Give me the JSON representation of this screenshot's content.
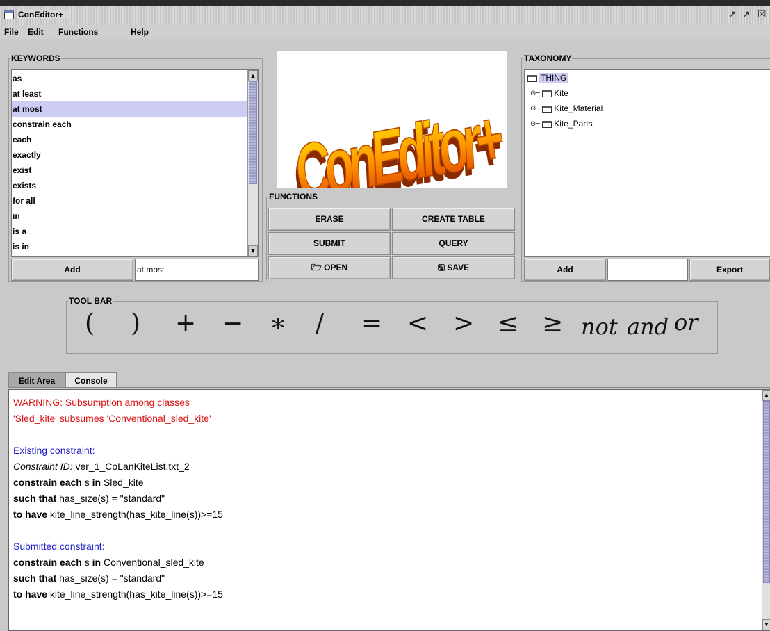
{
  "window": {
    "title": "ConEditor+",
    "controls": [
      "↗",
      "↗",
      "☒"
    ]
  },
  "menu": [
    "File",
    "Edit",
    "Functions",
    "Help"
  ],
  "keywords": {
    "title": "KEYWORDS",
    "items": [
      "as",
      "at least",
      "at most",
      "constrain each",
      "each",
      "exactly",
      "exist",
      "exists",
      "for all",
      "in",
      "is a",
      "is in"
    ],
    "selected_index": 2,
    "add_label": "Add",
    "field_value": "at most"
  },
  "logo": {
    "text": "ConEditor+"
  },
  "functions": {
    "title": "FUNCTIONS",
    "erase": "ERASE",
    "create_table": "CREATE TABLE",
    "submit": "SUBMIT",
    "query": "QUERY",
    "open": "OPEN",
    "save": "SAVE"
  },
  "taxonomy": {
    "title": "TAXONOMY",
    "root": "THING",
    "children": [
      "Kite",
      "Kite_Material",
      "Kite_Parts"
    ],
    "add_label": "Add",
    "field_value": "",
    "export_label": "Export"
  },
  "toolbar": {
    "title": "TOOL BAR",
    "symbols": [
      "(",
      ")",
      "+",
      "−",
      "∗",
      "/",
      "=",
      "<",
      ">",
      "≤",
      "≥"
    ],
    "words": [
      "not",
      "and",
      "or"
    ]
  },
  "tabs": [
    "Edit Area",
    "Console"
  ],
  "console": {
    "warning_1": "WARNING: Subsumption among classes",
    "warning_2": "'Sled_kite' subsumes 'Conventional_sled_kite'",
    "existing_header": "Existing constraint:",
    "id_label": "Constraint ID:",
    "id_value": " ver_1_CoLanKiteList.txt_2",
    "kw_constrain_each": "constrain each",
    "kw_in": "in",
    "kw_such_that": "such that",
    "kw_to_have": "to have",
    "var_s": " s ",
    "existing_class": " Sled_kite",
    "such_that_expr": " has_size(s) = \"standard\"",
    "to_have_expr": " kite_line_strength(has_kite_line(s))>=15",
    "submitted_header": "Submitted constraint:",
    "submitted_class": " Conventional_sled_kite"
  }
}
